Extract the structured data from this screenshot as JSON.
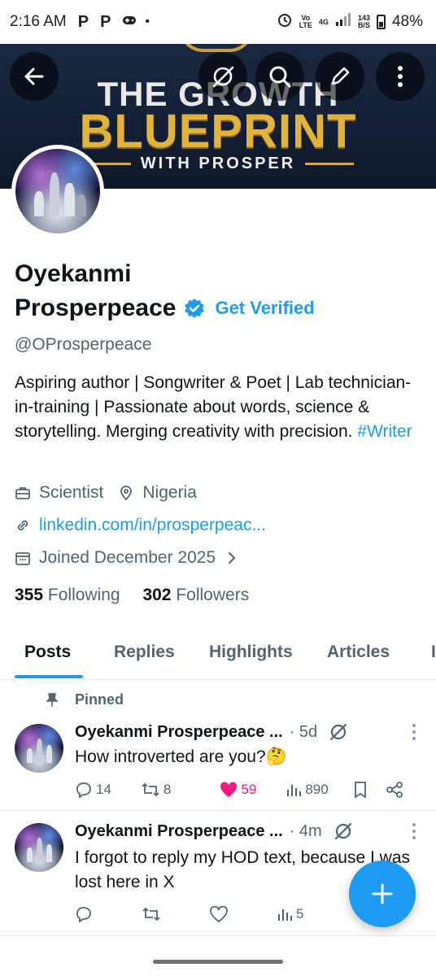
{
  "status": {
    "time": "2:16 AM",
    "app_icons": [
      "P",
      "P"
    ],
    "net_top": "Vo",
    "net_bottom": "LTE",
    "net_gen": "4G",
    "speed_top": "143",
    "speed_bottom": "B/S",
    "battery": "48%"
  },
  "banner": {
    "line1": "THE GROWTH",
    "line2": "BLUEPRINT",
    "line3": "WITH PROSPER"
  },
  "profile": {
    "name_line1": "Oyekanmi",
    "name_line2": "Prosperpeace",
    "get_verified": "Get Verified",
    "handle": "@OProsperpeace",
    "bio_text": "Aspiring author | Songwriter & Poet | Lab technician-in-training | Passionate about words, science & storytelling. Merging creativity with precision. ",
    "bio_hashtag": "#Writer",
    "profession": "Scientist",
    "location": "Nigeria",
    "link": "linkedin.com/in/prosperpeac...",
    "joined": "Joined December 2025",
    "following_count": "355",
    "following_label": "Following",
    "followers_count": "302",
    "followers_label": "Followers"
  },
  "tabs": [
    "Posts",
    "Replies",
    "Highlights",
    "Articles"
  ],
  "pinned_label": "Pinned",
  "posts": [
    {
      "name": "Oyekanmi Prosperpeace ...",
      "time": "· 5d",
      "text": "How introverted are you?🤔",
      "replies": "14",
      "reposts": "8",
      "likes": "59",
      "views": "890"
    },
    {
      "name": "Oyekanmi Prosperpeace ...",
      "time": "· 4m",
      "text": "I forgot to reply my HOD text, because I was lost here in X",
      "replies": "",
      "reposts": "",
      "likes": "",
      "views": "5"
    }
  ],
  "colors": {
    "accent": "#1d9bf0",
    "like": "#f91880",
    "banner_gold": "#e1b23c",
    "banner_bg": "#142036"
  }
}
